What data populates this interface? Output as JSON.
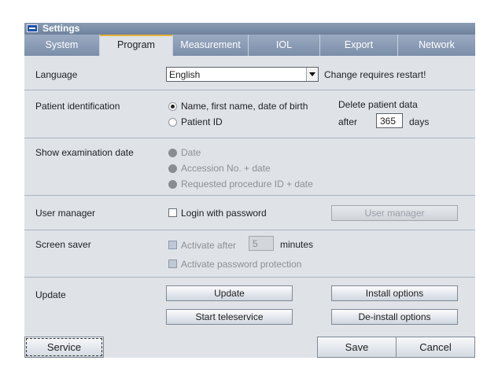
{
  "window": {
    "title": "Settings"
  },
  "tabs": [
    {
      "label": "System"
    },
    {
      "label": "Program",
      "active": true
    },
    {
      "label": "Measurement"
    },
    {
      "label": "IOL"
    },
    {
      "label": "Export"
    },
    {
      "label": "Network"
    }
  ],
  "language": {
    "label": "Language",
    "value": "English",
    "note": "Change requires restart!"
  },
  "patient_id": {
    "label": "Patient identification",
    "options": [
      "Name, first name, date of birth",
      "Patient ID"
    ],
    "selected": 0,
    "delete_title": "Delete patient data",
    "after_label": "after",
    "days_value": "365",
    "days_label": "days"
  },
  "exam_date": {
    "label": "Show examination date",
    "options": [
      "Date",
      "Accession No. + date",
      "Requested procedure ID + date"
    ]
  },
  "user_manager": {
    "label": "User manager",
    "login_label": "Login with password",
    "button": "User manager"
  },
  "screen_saver": {
    "label": "Screen saver",
    "activate_label": "Activate after",
    "minutes_value": "5",
    "minutes_label": "minutes",
    "password_label": "Activate password protection"
  },
  "update": {
    "label": "Update",
    "update_btn": "Update",
    "install_btn": "Install options",
    "teleservice_btn": "Start teleservice",
    "deinstall_btn": "De-install options"
  },
  "footer": {
    "service": "Service",
    "save": "Save",
    "cancel": "Cancel"
  },
  "colors": {
    "tab_accent": "#e7b33b",
    "tab_bg": "#8b9db6",
    "panel_bg": "#dfe3e8"
  }
}
